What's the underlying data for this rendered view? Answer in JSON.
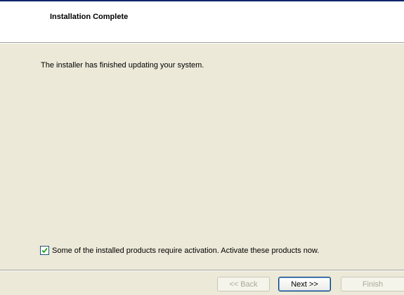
{
  "header": {
    "title": "Installation Complete"
  },
  "main": {
    "message": "The installer has finished updating your system."
  },
  "activation": {
    "checked": true,
    "label": "Some of the installed products require activation. Activate these products now."
  },
  "buttons": {
    "back": "<< Back",
    "next": "Next >>",
    "finish": "Finish"
  },
  "colors": {
    "dialog_bg": "#ece9d8",
    "header_bg": "#ffffff",
    "checkmark": "#21a121",
    "default_button_border": "#003c74"
  }
}
